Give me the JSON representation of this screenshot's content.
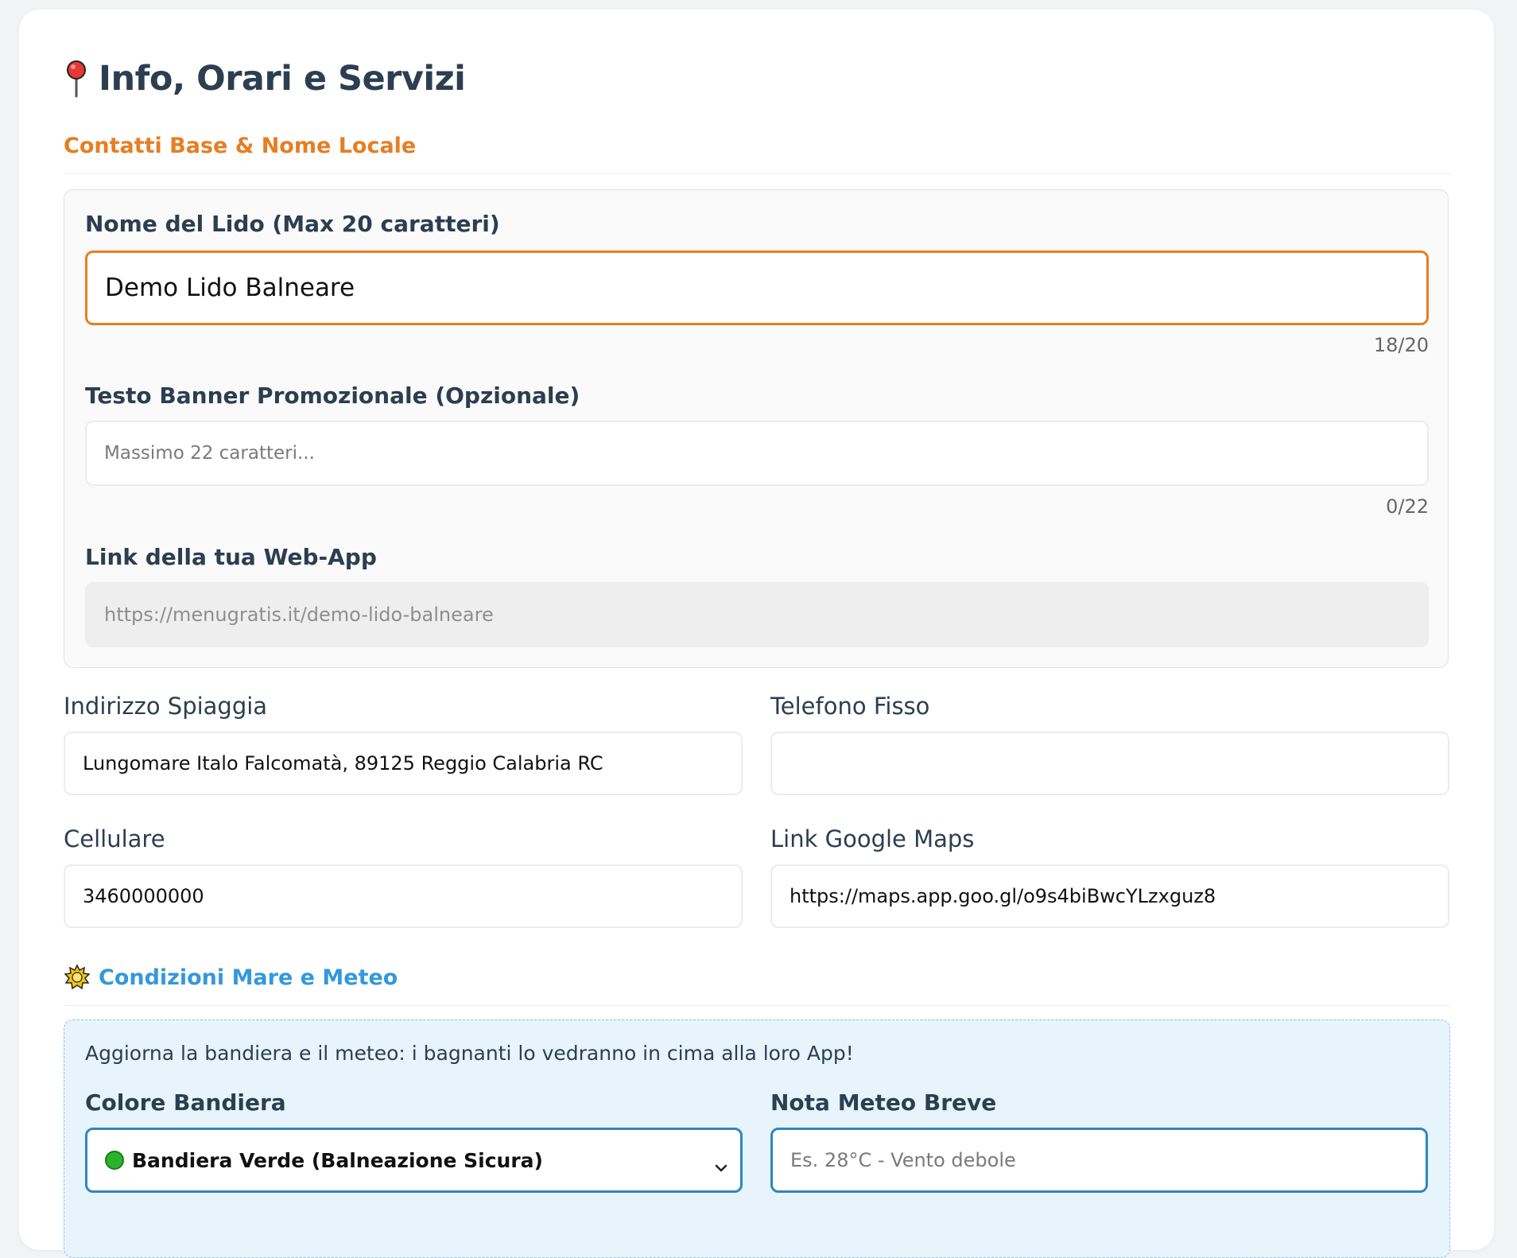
{
  "page": {
    "title": "Info, Orari e Servizi"
  },
  "contacts_section": {
    "title": "Contatti Base & Nome Locale",
    "name_label": "Nome del Lido (Max 20 caratteri)",
    "name_value": "Demo Lido Balneare",
    "name_counter": "18/20",
    "banner_label": "Testo Banner Promozionale (Opzionale)",
    "banner_placeholder": "Massimo 22 caratteri...",
    "banner_counter": "0/22",
    "link_label": "Link della tua Web-App",
    "link_value": "https://menugratis.it/demo-lido-balneare"
  },
  "address": {
    "label": "Indirizzo Spiaggia",
    "value": "Lungomare Italo Falcomatà, 89125 Reggio Calabria RC"
  },
  "landline": {
    "label": "Telefono Fisso",
    "value": ""
  },
  "mobile": {
    "label": "Cellulare",
    "value": "3460000000"
  },
  "maps": {
    "label": "Link Google Maps",
    "value": "https://maps.app.goo.gl/o9s4biBwcYLzxguz8"
  },
  "meteo_section": {
    "title": "Condizioni Mare e Meteo",
    "note": "Aggiorna la bandiera e il meteo: i bagnanti lo vedranno in cima alla loro App!",
    "flag_label": "Colore Bandiera",
    "flag_value": "Bandiera Verde (Balneazione Sicura)",
    "weather_label": "Nota Meteo Breve",
    "weather_placeholder": "Es. 28°C - Vento debole"
  },
  "colors": {
    "accent_orange": "#e67e22",
    "accent_blue": "#3498db",
    "flag_green": "#2bb32b"
  },
  "icons": {
    "title_icon": "pushpin-icon",
    "meteo_icon": "sun-cloud-icon",
    "flag_icon": "green-circle-icon",
    "select_icon": "chevron-down-icon"
  }
}
